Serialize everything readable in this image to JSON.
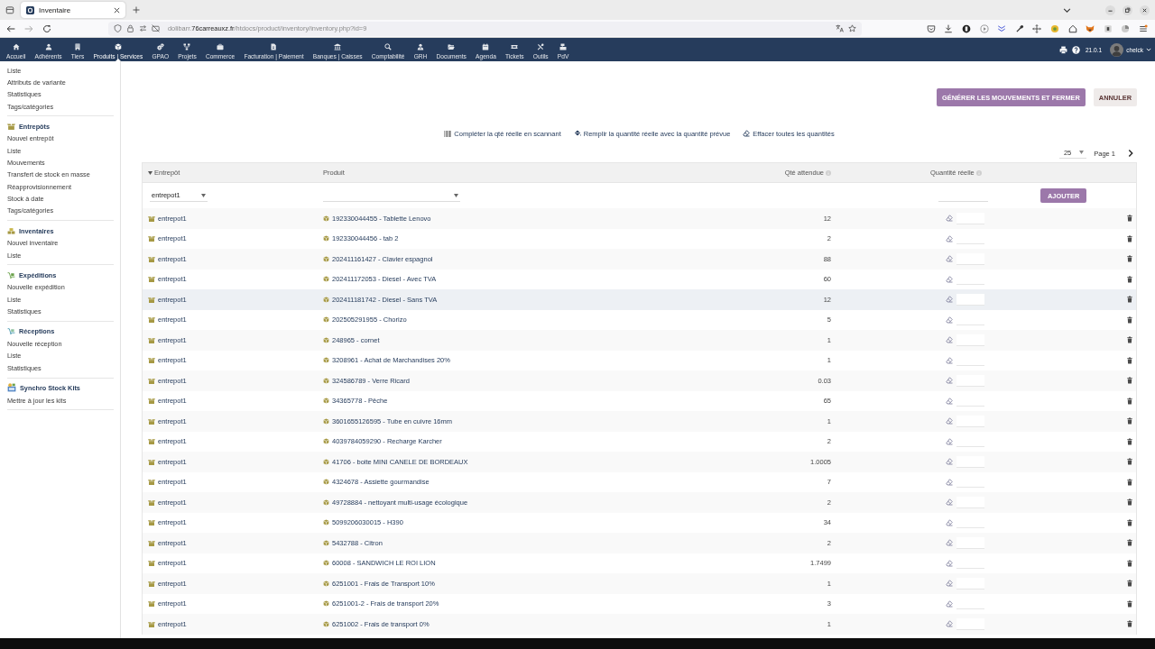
{
  "browser": {
    "tabs": [
      {
        "title": "Inventaire",
        "selected": true
      }
    ],
    "url": {
      "prefix": "dolibarr.",
      "domain": "76carreauxz.fr",
      "path": "/htdocs/product/inventory/inventory.php?id=9"
    }
  },
  "top_menu": {
    "items": [
      {
        "label": "Accueil",
        "selected": false
      },
      {
        "label": "Adhérents",
        "selected": false
      },
      {
        "label": "Tiers",
        "selected": false
      },
      {
        "label": "Produits | Services",
        "selected": true
      },
      {
        "label": "GPAO",
        "selected": false
      },
      {
        "label": "Projets",
        "selected": false
      },
      {
        "label": "Commerce",
        "selected": false
      },
      {
        "label": "Facturation | Paiement",
        "selected": false
      },
      {
        "label": "Banques | Caisses",
        "selected": false
      },
      {
        "label": "Comptabilité",
        "selected": false
      },
      {
        "label": "GRH",
        "selected": false
      },
      {
        "label": "Documents",
        "selected": false
      },
      {
        "label": "Agenda",
        "selected": false
      },
      {
        "label": "Tickets",
        "selected": false
      },
      {
        "label": "Outils",
        "selected": false
      },
      {
        "label": "PdV",
        "selected": false
      }
    ],
    "version": "21.0.1",
    "user": "chelck"
  },
  "sidebar": {
    "sections": [
      {
        "items": [
          "Liste",
          "Attributs de variante",
          "Statistiques",
          "Tags/catégories"
        ]
      },
      {
        "title": "Entrepôts",
        "items": [
          "Nouvel entrepôt",
          "Liste",
          "Mouvements",
          "Transfert de stock en masse",
          "Réapprovisionnement",
          "Stock à date",
          "Tags/catégories"
        ]
      },
      {
        "title": "Inventaires",
        "items": [
          "Nouvel inventaire",
          "Liste"
        ]
      },
      {
        "title": "Expéditions",
        "items": [
          "Nouvelle expédition",
          "Liste",
          "Statistiques"
        ]
      },
      {
        "title": "Réceptions",
        "items": [
          "Nouvelle réception",
          "Liste",
          "Statistiques"
        ]
      },
      {
        "title": "Synchro Stock Kits",
        "items": [
          "Mettre à jour les kits"
        ]
      }
    ]
  },
  "actions": [
    {
      "label": "GÉNÉRER LES MOUVEMENTS ET FERMER",
      "kind": "primary"
    },
    {
      "label": "ANNULER",
      "kind": "secondary"
    }
  ],
  "tools": [
    "Compléter la qté réelle en scannant",
    "Remplir la quantité réelle avec la quantité prévue",
    "Effacer toutes les quantités"
  ],
  "pagination": {
    "page_size": "25",
    "page": "Page 1"
  },
  "table": {
    "columns": [
      {
        "label": "Entrepôt",
        "sorted": true,
        "info": false
      },
      {
        "label": "Produit",
        "sorted": false,
        "info": false
      },
      {
        "label": "Qté attendue",
        "sorted": false,
        "info": true
      },
      {
        "label": "Quantité réelle",
        "sorted": false,
        "info": true
      }
    ],
    "add_row": {
      "warehouse": "entrepot1",
      "button": "AJOUTER"
    },
    "rows": [
      {
        "warehouse": "entrepot1",
        "product": "192330044455 - Tablette Lenovo",
        "expected": "12",
        "highlighted": false
      },
      {
        "warehouse": "entrepot1",
        "product": "192330044456 - tab 2",
        "expected": "2",
        "highlighted": false
      },
      {
        "warehouse": "entrepot1",
        "product": "202411161427 - Clavier espagnol",
        "expected": "88",
        "highlighted": false
      },
      {
        "warehouse": "entrepot1",
        "product": "202411172053 - Diesel - Avec TVA",
        "expected": "60",
        "highlighted": false
      },
      {
        "warehouse": "entrepot1",
        "product": "202411181742 - Diesel - Sans TVA",
        "expected": "12",
        "highlighted": true
      },
      {
        "warehouse": "entrepot1",
        "product": "202505291955 - Chorizo",
        "expected": "5",
        "highlighted": false
      },
      {
        "warehouse": "entrepot1",
        "product": "248965 - cornet",
        "expected": "1",
        "highlighted": false
      },
      {
        "warehouse": "entrepot1",
        "product": "3208961 - Achat de Marchandises 20%",
        "expected": "1",
        "highlighted": false
      },
      {
        "warehouse": "entrepot1",
        "product": "324586789 - Verre Ricard",
        "expected": "0.03",
        "highlighted": false
      },
      {
        "warehouse": "entrepot1",
        "product": "34365778 - Pêche",
        "expected": "65",
        "highlighted": false
      },
      {
        "warehouse": "entrepot1",
        "product": "3601655126595 - Tube en cuivre 16mm",
        "expected": "1",
        "highlighted": false
      },
      {
        "warehouse": "entrepot1",
        "product": "4039784059290 - Recharge Karcher",
        "expected": "2",
        "highlighted": false
      },
      {
        "warehouse": "entrepot1",
        "product": "41706 - boite MINI CANELE DE BORDEAUX",
        "expected": "1.0005",
        "highlighted": false
      },
      {
        "warehouse": "entrepot1",
        "product": "4324678 - Assiette gourmandise",
        "expected": "7",
        "highlighted": false
      },
      {
        "warehouse": "entrepot1",
        "product": "49728884 - nettoyant multi-usage écologique",
        "expected": "2",
        "highlighted": false
      },
      {
        "warehouse": "entrepot1",
        "product": "5099206030015 - H390",
        "expected": "34",
        "highlighted": false
      },
      {
        "warehouse": "entrepot1",
        "product": "5432788 - Citron",
        "expected": "2",
        "highlighted": false
      },
      {
        "warehouse": "entrepot1",
        "product": "60008 - SANDWICH LE ROI LION",
        "expected": "1.7499",
        "highlighted": false
      },
      {
        "warehouse": "entrepot1",
        "product": "6251001 - Frais de Transport 10%",
        "expected": "1",
        "highlighted": false
      },
      {
        "warehouse": "entrepot1",
        "product": "6251001-2 - Frais de transport 20%",
        "expected": "3",
        "highlighted": false
      },
      {
        "warehouse": "entrepot1",
        "product": "6251002 - Frais de transport 0%",
        "expected": "1",
        "highlighted": false
      }
    ]
  }
}
